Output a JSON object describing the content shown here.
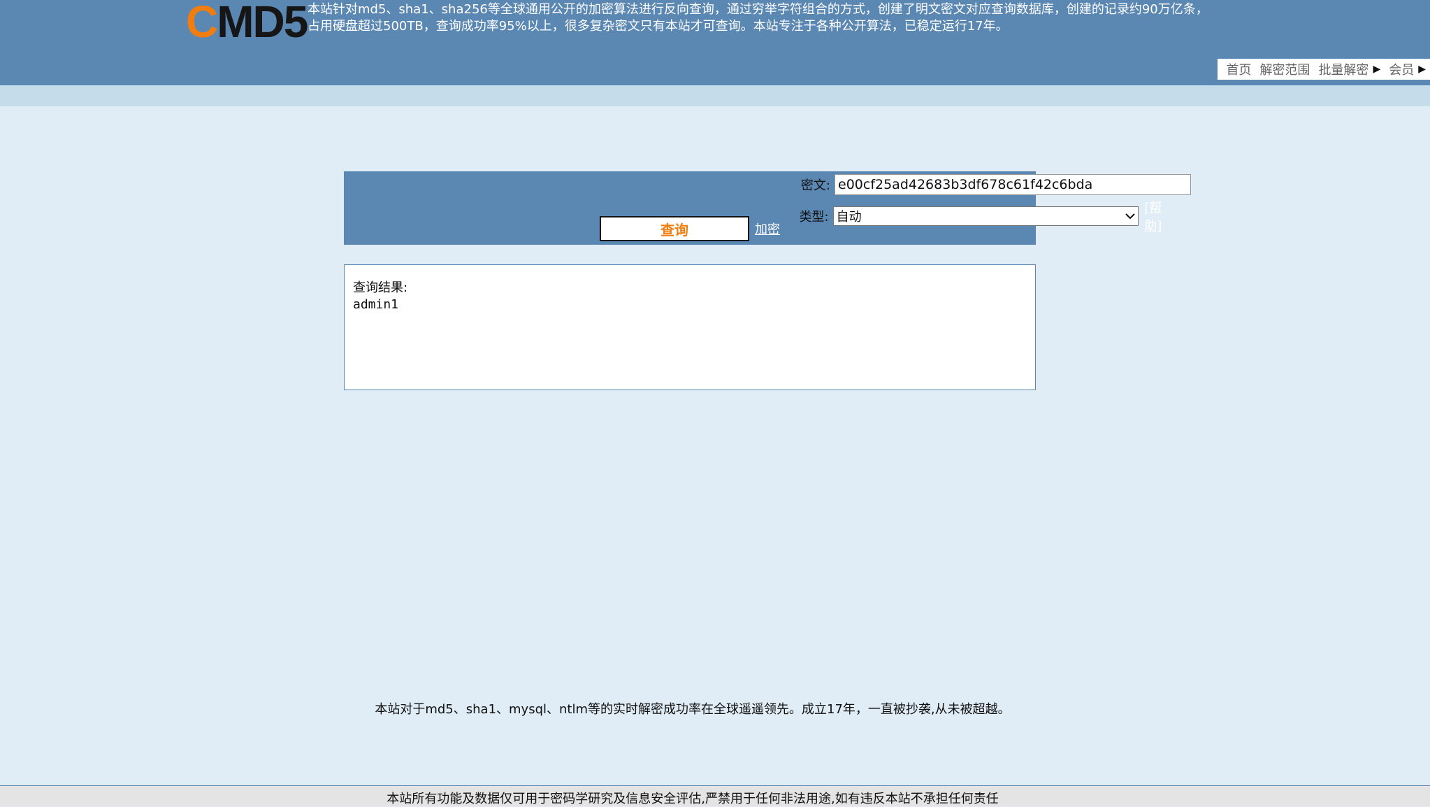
{
  "header": {
    "logo": {
      "first_letter": "C",
      "rest": "MD5"
    },
    "intro_line1": "本站针对md5、sha1、sha256等全球通用公开的加密算法进行反向查询，通过穷举字符组合的方式，创建了明文密文对应查询数据库，创建的记录约90万亿条，",
    "intro_line2": "占用硬盘超过500TB，查询成功率95%以上，很多复杂密文只有本站才可查询。本站专注于各种公开算法，已稳定运行17年。"
  },
  "nav": {
    "items": [
      {
        "label": "首页",
        "has_arrow": false
      },
      {
        "label": "解密范围",
        "has_arrow": false
      },
      {
        "label": "批量解密",
        "has_arrow": true
      },
      {
        "label": "会员",
        "has_arrow": true
      }
    ]
  },
  "form": {
    "hash_label": "密文:",
    "hash_value": "e00cf25ad42683b3df678c61f42c6bda",
    "type_label": "类型:",
    "type_selected": "自动",
    "help_link": "[帮助]",
    "query_button": "查询",
    "encrypt_link": "加密"
  },
  "result": {
    "label": "查询结果:",
    "value": "admin1"
  },
  "footer": {
    "note": "本站对于md5、sha1、mysql、ntlm等的实时解密成功率在全球遥遥领先。成立17年，一直被抄袭,从未被超越。",
    "disclaimer": "本站所有功能及数据仅可用于密码学研究及信息安全评估,严禁用于任何非法用途,如有违反本站不承担任何责任"
  },
  "colors": {
    "header_bg": "#5b87b3",
    "page_bg": "#e1edf6",
    "accent_orange": "#f07d0e"
  }
}
